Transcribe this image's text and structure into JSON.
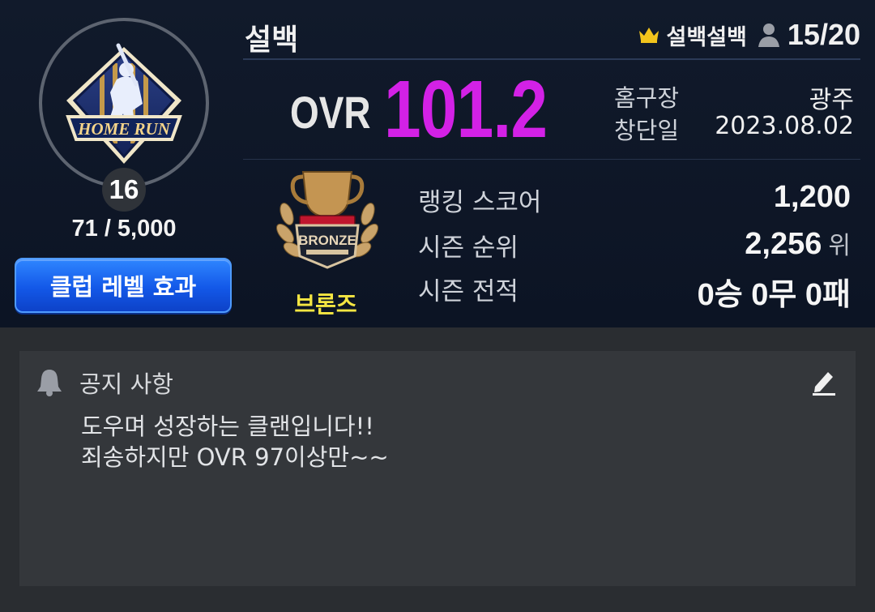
{
  "club": {
    "name": "설백",
    "emblem_text": "HOME RUN",
    "level": "16",
    "exp": "71 / 5,000",
    "level_effect_button": "클럽 레벨 효과"
  },
  "master": {
    "name": "설백설백",
    "member_count": "15/20",
    "crown_icon": "crown-icon",
    "member_icon": "person-icon"
  },
  "ovr": {
    "label": "OVR",
    "value": "101.2",
    "color": "#d321e6"
  },
  "info": {
    "home_label": "홈구장",
    "home_value": "광주",
    "founded_label": "창단일",
    "founded_value": "2023.08.02"
  },
  "tier": {
    "emblem_text": "BRONZE",
    "name": "브론즈",
    "color": "#f5e642"
  },
  "stats": {
    "ranking_label": "랭킹 스코어",
    "ranking_value": "1,200",
    "season_rank_label": "시즌 순위",
    "season_rank_value": "2,256",
    "season_rank_unit": "위",
    "season_record_label": "시즌 전적",
    "season_record_value": "0승 0무 0패"
  },
  "notice": {
    "title": "공지 사항",
    "icon": "bell-icon",
    "edit_icon": "pencil-icon",
    "line1": "도우며 성장하는 클랜입니다!!",
    "line2": "죄송하지만 OVR 97이상만~~"
  }
}
